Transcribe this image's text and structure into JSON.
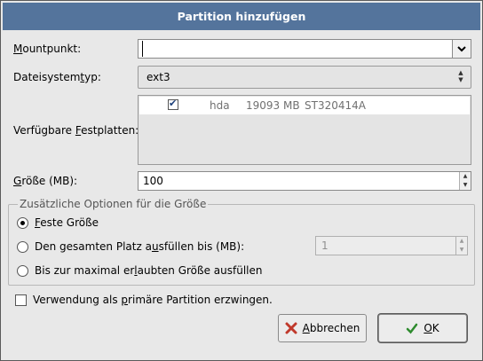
{
  "dialog": {
    "title": "Partition hinzufügen"
  },
  "mountpoint": {
    "label": "Mountpunkt:",
    "value": ""
  },
  "fstype": {
    "label": "Dateisystemtyp:",
    "value": "ext3"
  },
  "drives": {
    "label": "Verfügbare Festplatten:",
    "rows": [
      {
        "checked": true,
        "device": "hda",
        "size": "19093 MB",
        "model": "ST320414A"
      }
    ]
  },
  "size": {
    "label": "Größe (MB):",
    "value": "100"
  },
  "options": {
    "title": "Zusätzliche Optionen für die Größe",
    "fixed_label": "Feste Größe",
    "fill_upto_label": "Den gesamten Platz ausfüllen bis (MB):",
    "fill_upto_value": "1",
    "fill_max_label": "Bis zur maximal erlaubten Größe ausfüllen",
    "selected": "fixed"
  },
  "primary": {
    "label": "Verwendung als primäre Partition erzwingen.",
    "checked": false
  },
  "buttons": {
    "cancel": "Abbrechen",
    "ok": "OK"
  },
  "icons": {
    "cancel": "cancel-x-icon",
    "ok": "ok-check-icon"
  },
  "colors": {
    "titlebar": "#54749c",
    "cancel_icon": "#c0392b",
    "ok_icon": "#2e8b2e"
  }
}
